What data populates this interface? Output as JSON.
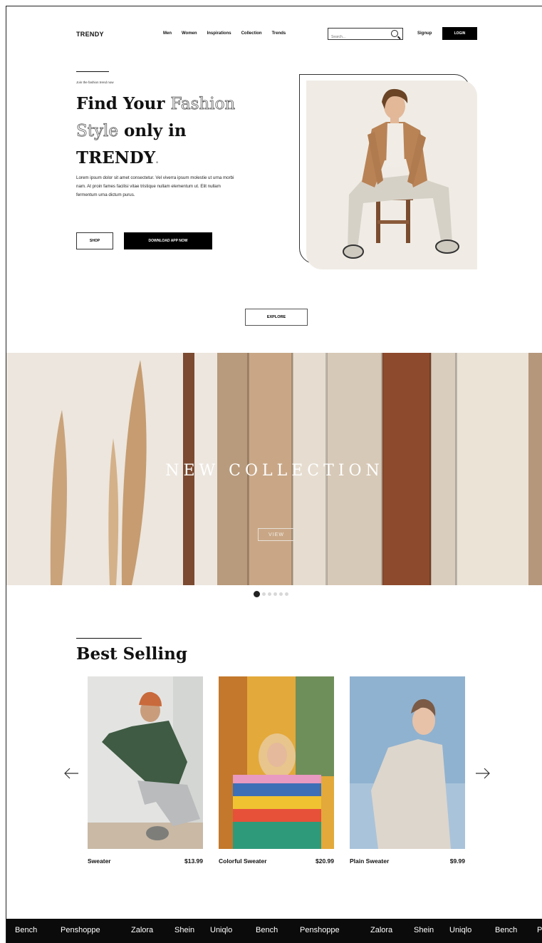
{
  "nav": {
    "brand": "TRENDY",
    "links": [
      "Men",
      "Women",
      "Inspirations",
      "Collection",
      "Trends"
    ],
    "search_placeholder": "Search...",
    "signup": "Signup",
    "login": "LOGIN"
  },
  "hero": {
    "kicker": "Join the fashion trend now",
    "title_part1": "Find Your ",
    "title_outline1": "Fashion",
    "title_outline2": "Style",
    "title_part2": " only  in",
    "title_part3": "TRENDY",
    "title_dot": ".",
    "description": "Lorem ipsum dolor sit amet consectetur. Vel viverra ipsum molestie ut urna morbi nam. At proin fames facilisi vitae tristique nullam elementum ut. Elit nullam fermentum urna dictum purus.",
    "shop": "SHOP",
    "download": "DOWNLOAD APP NOW",
    "explore": "EXPLORE"
  },
  "banner": {
    "title": "NEW COLLECTION",
    "view": "VIEW",
    "slides": 6,
    "active_slide": 1
  },
  "best_selling": {
    "title": "Best Selling",
    "products": [
      {
        "name": "Sweater",
        "price": "$13.99"
      },
      {
        "name": "Colorful Sweater",
        "price": "$20.99"
      },
      {
        "name": "Plain Sweater",
        "price": "$9.99"
      }
    ]
  },
  "brands": [
    "Bench",
    "Penshoppe",
    "Zalora",
    "Shein",
    "Uniqlo",
    "Bench",
    "Penshoppe",
    "Zalora",
    "Shein",
    "Uniqlo",
    "Bench",
    "P"
  ],
  "colors": {
    "accent": "#000000",
    "banner_bg": "#eae3da",
    "hero_photo_bg": "#f0ece5"
  }
}
